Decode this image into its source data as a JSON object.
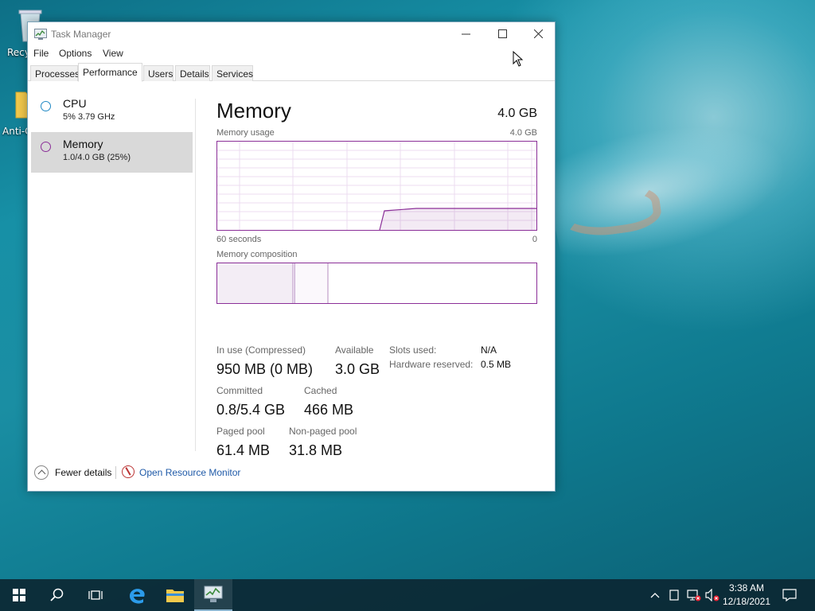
{
  "desktop": {
    "icons": [
      {
        "label": "Recy",
        "icon": "recycle-bin-icon"
      },
      {
        "label": "Anti-C",
        "icon": "folder-icon"
      }
    ]
  },
  "window": {
    "title": "Task Manager",
    "menu": [
      "File",
      "Options",
      "View"
    ],
    "tabs": [
      "Processes",
      "Performance",
      "Users",
      "Details",
      "Services"
    ],
    "active_tab": "Performance"
  },
  "sidebar": {
    "items": [
      {
        "name": "CPU",
        "sub": "5%  3.79 GHz",
        "color": "#1f88c4"
      },
      {
        "name": "Memory",
        "sub": "1.0/4.0 GB (25%)",
        "color": "#8b2f98",
        "selected": true
      }
    ]
  },
  "memory": {
    "title": "Memory",
    "total": "4.0 GB",
    "usage_label": "Memory usage",
    "usage_max": "4.0 GB",
    "axis_left": "60 seconds",
    "axis_right": "0",
    "composition_label": "Memory composition",
    "stats": {
      "in_use_label": "In use (Compressed)",
      "in_use_value": "950 MB (0 MB)",
      "available_label": "Available",
      "available_value": "3.0 GB",
      "committed_label": "Committed",
      "committed_value": "0.8/5.4 GB",
      "cached_label": "Cached",
      "cached_value": "466 MB",
      "paged_label": "Paged pool",
      "paged_value": "61.4 MB",
      "nonpaged_label": "Non-paged pool",
      "nonpaged_value": "31.8 MB",
      "slots_label": "Slots used:",
      "slots_value": "N/A",
      "hw_reserved_label": "Hardware reserved:",
      "hw_reserved_value": "0.5 MB"
    },
    "accent_color": "#8b2f98"
  },
  "footer": {
    "fewer_details": "Fewer details",
    "open_resource_monitor": "Open Resource Monitor"
  },
  "taskbar": {
    "items": [
      "start-icon",
      "search-icon",
      "task-view-icon",
      "edge-icon",
      "file-explorer-icon",
      "task-manager-icon"
    ],
    "tray": [
      "chevron-up-icon",
      "tablet-icon",
      "network-icon",
      "volume-muted-icon"
    ],
    "time": "3:38 AM",
    "date": "12/18/2021"
  }
}
